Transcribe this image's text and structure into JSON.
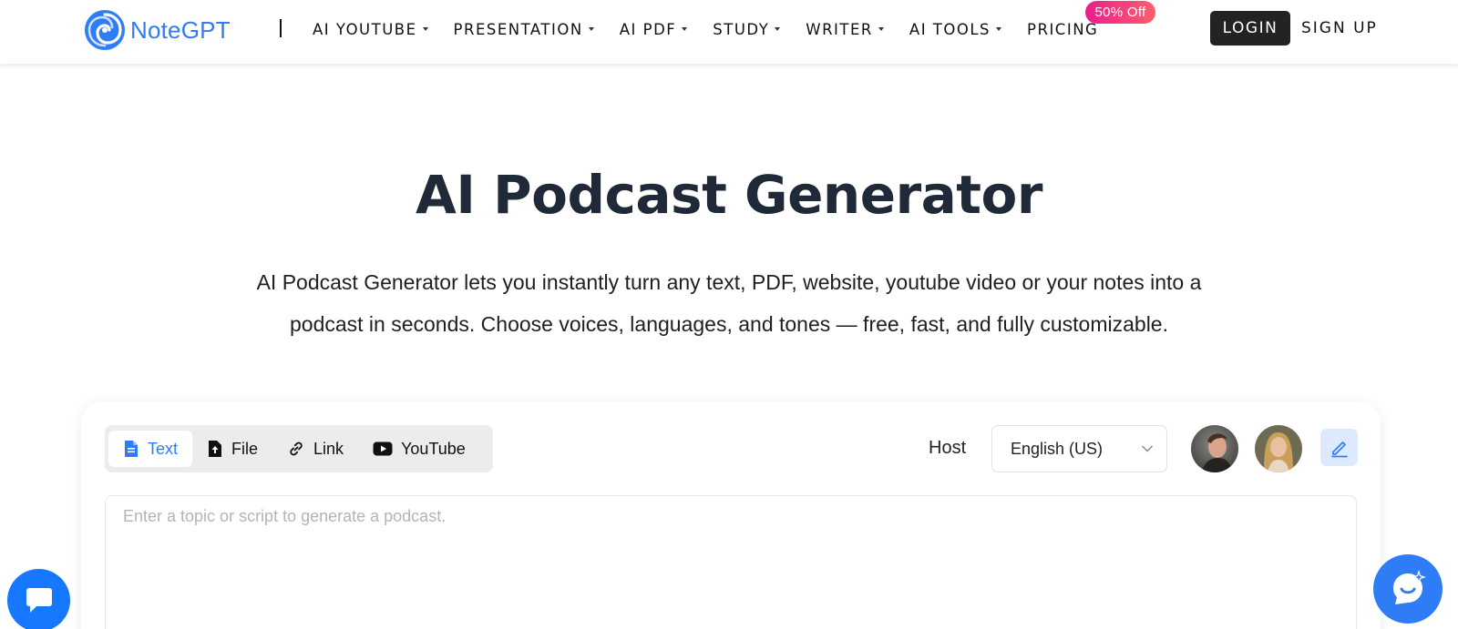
{
  "header": {
    "logo_text": "NoteGPT",
    "nav": [
      {
        "label": "AI YOUTUBE"
      },
      {
        "label": "PRESENTATION"
      },
      {
        "label": "AI PDF"
      },
      {
        "label": "STUDY"
      },
      {
        "label": "WRITER"
      },
      {
        "label": "AI TOOLS"
      },
      {
        "label": "PRICING"
      }
    ],
    "badge": "50% Off",
    "login": "LOGIN",
    "signup": "SIGN UP"
  },
  "hero": {
    "title": "AI Podcast Generator",
    "subtitle_line1": "AI Podcast Generator lets you instantly turn any text, PDF, website, youtube video or your notes into a",
    "subtitle_line2": "podcast in seconds. Choose voices, languages, and tones — free, fast, and fully customizable."
  },
  "card": {
    "tabs": [
      {
        "label": "Text",
        "icon": "document-icon",
        "active": true
      },
      {
        "label": "File",
        "icon": "upload-icon",
        "active": false
      },
      {
        "label": "Link",
        "icon": "link-icon",
        "active": false
      },
      {
        "label": "YouTube",
        "icon": "youtube-icon",
        "active": false
      }
    ],
    "host_label": "Host",
    "language": "English (US)",
    "placeholder": "Enter a topic or script to generate a podcast."
  },
  "colors": {
    "brand": "#2f7df6",
    "badge_start": "#e91e8c",
    "badge_end": "#ff5e6c",
    "dark_button": "#232323"
  }
}
